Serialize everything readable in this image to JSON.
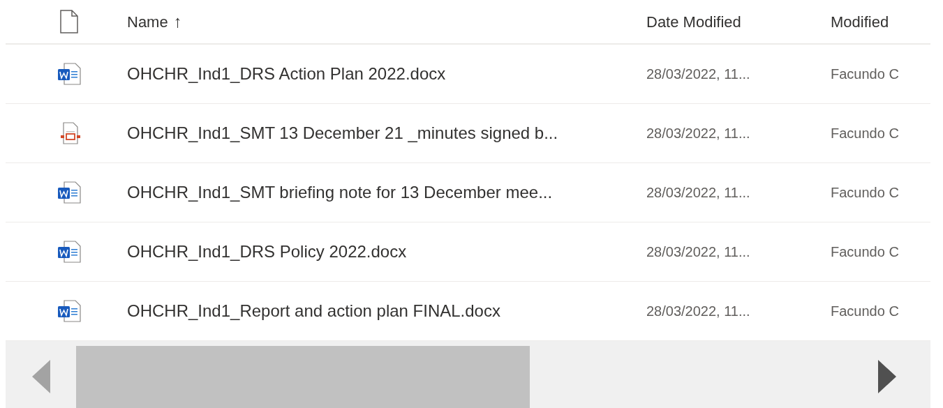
{
  "table": {
    "columns": [
      {
        "kind": "icon"
      },
      {
        "kind": "name",
        "label": "Name",
        "sort_indicator": "↑"
      },
      {
        "kind": "date",
        "label": "Date Modified"
      },
      {
        "kind": "author",
        "label": "Modified"
      }
    ],
    "rows": [
      {
        "kind": "word",
        "name": "OHCHR_Ind1_DRS Action Plan 2022.docx",
        "date_modified": "28/03/2022, 11...",
        "modified_by": "Facundo C"
      },
      {
        "kind": "pdf",
        "name": "OHCHR_Ind1_SMT 13 December 21 _minutes signed b...",
        "date_modified": "28/03/2022, 11...",
        "modified_by": "Facundo C"
      },
      {
        "kind": "word",
        "name": "OHCHR_Ind1_SMT briefing note for 13 December mee...",
        "date_modified": "28/03/2022, 11...",
        "modified_by": "Facundo C"
      },
      {
        "kind": "word",
        "name": "OHCHR_Ind1_DRS Policy 2022.docx",
        "date_modified": "28/03/2022, 11...",
        "modified_by": "Facundo C"
      },
      {
        "kind": "word",
        "name": "OHCHR_Ind1_Report and action plan FINAL.docx",
        "date_modified": "28/03/2022, 11...",
        "modified_by": "Facundo C"
      }
    ]
  }
}
